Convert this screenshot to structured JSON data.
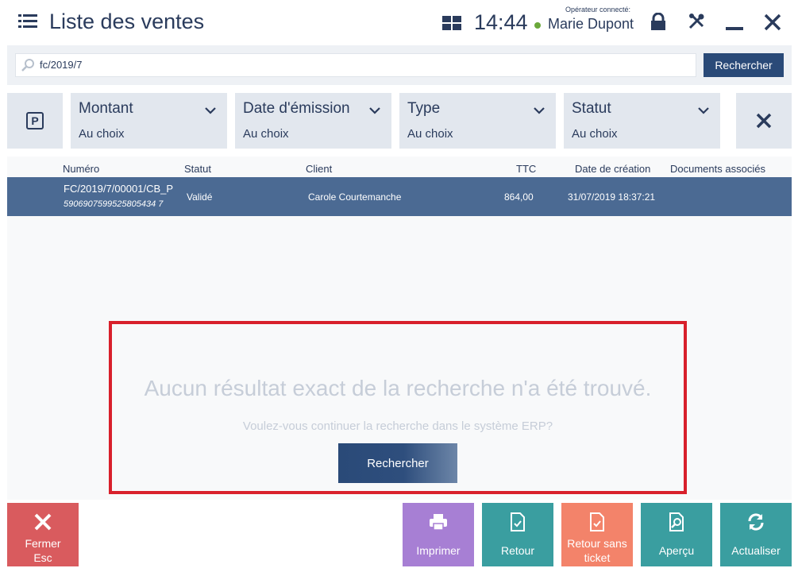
{
  "header": {
    "title": "Liste des ventes",
    "clock": "14:44",
    "operator_label": "Opérateur connecté:",
    "operator_name": "Marie Dupont",
    "status_color": "#6ba83a"
  },
  "search": {
    "value": "fc/2019/7",
    "button_label": "Rechercher"
  },
  "filters": [
    {
      "label": "Montant",
      "value": "Au choix"
    },
    {
      "label": "Date d'émission",
      "value": "Au choix"
    },
    {
      "label": "Type",
      "value": "Au choix"
    },
    {
      "label": "Statut",
      "value": "Au choix"
    }
  ],
  "table": {
    "columns": [
      "Numéro",
      "Statut",
      "Client",
      "TTC",
      "Date de création",
      "Documents associés"
    ],
    "rows": [
      {
        "numero": "FC/2019/7/00001/CB_P",
        "code": "5906907599525805434 7",
        "statut": "Validé",
        "client": "Carole Courtemanche",
        "ttc": "864,00",
        "date": "31/07/2019 18:37:21",
        "documents": ""
      }
    ]
  },
  "no_result": {
    "title": "Aucun résultat exact de la recherche n'a été trouvé.",
    "subtitle": "Voulez-vous continuer la recherche dans le système ERP?",
    "button_label": "Rechercher"
  },
  "actions": {
    "close": {
      "label": "Fermer",
      "shortcut": "Esc"
    },
    "print": {
      "label": "Imprimer"
    },
    "return": {
      "label": "Retour"
    },
    "return_no_ticket": {
      "label_line1": "Retour sans",
      "label_line2": "ticket"
    },
    "preview": {
      "label": "Aperçu"
    },
    "refresh": {
      "label": "Actualiser"
    }
  },
  "colors": {
    "accent": "#2a4a78",
    "selected_row": "#4b6a93",
    "highlight_border": "#d8202b",
    "close_button": "#d95b5e",
    "print_button": "#a77fd4",
    "teal_button": "#3a9ea0",
    "return_no_ticket_button": "#f3836a"
  }
}
